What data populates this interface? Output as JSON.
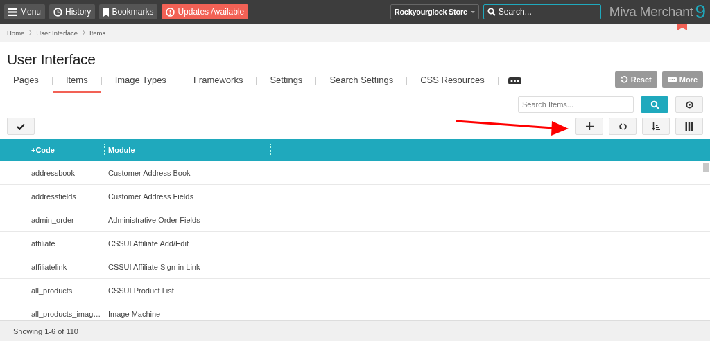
{
  "topbar": {
    "buttons": [
      {
        "label": "Menu",
        "kind": "menu"
      },
      {
        "label": "History",
        "kind": "history"
      },
      {
        "label": "Bookmarks",
        "kind": "bookmark"
      },
      {
        "label": "Updates Available",
        "kind": "alert"
      }
    ],
    "store": "Rockyourglock Store",
    "search": {
      "placeholder": "Search..."
    },
    "logo": {
      "text": "Miva Merchant",
      "mark": "9"
    }
  },
  "breadcrumb": [
    "Home",
    "User Interface",
    "Items"
  ],
  "page_title": "User Interface",
  "tabs": [
    {
      "label": "Pages",
      "selected": false
    },
    {
      "label": "Items",
      "selected": true
    },
    {
      "label": "Image Types",
      "selected": false
    },
    {
      "label": "Frameworks",
      "selected": false
    },
    {
      "label": "Settings",
      "selected": false
    },
    {
      "label": "Search Settings",
      "selected": false
    },
    {
      "label": "CSS Resources",
      "selected": false
    }
  ],
  "actions": [
    {
      "label": "Reset",
      "kind": "reset"
    },
    {
      "label": "More",
      "kind": "more"
    }
  ],
  "search_items": {
    "placeholder": "Search Items..."
  },
  "table": {
    "columns": [
      "+Code",
      "Module"
    ],
    "rows": [
      [
        "addressbook",
        "Customer Address Book"
      ],
      [
        "addressfields",
        "Customer Address Fields"
      ],
      [
        "admin_order",
        "Administrative Order Fields"
      ],
      [
        "affiliate",
        "CSSUI Affiliate Add/Edit"
      ],
      [
        "affiliatelink",
        "CSSUI Affiliate Sign-in Link"
      ],
      [
        "all_products",
        "CSSUI Product List"
      ],
      [
        "all_products_imag…",
        "Image Machine"
      ]
    ]
  },
  "status_bar": "Showing 1-6 of 110"
}
